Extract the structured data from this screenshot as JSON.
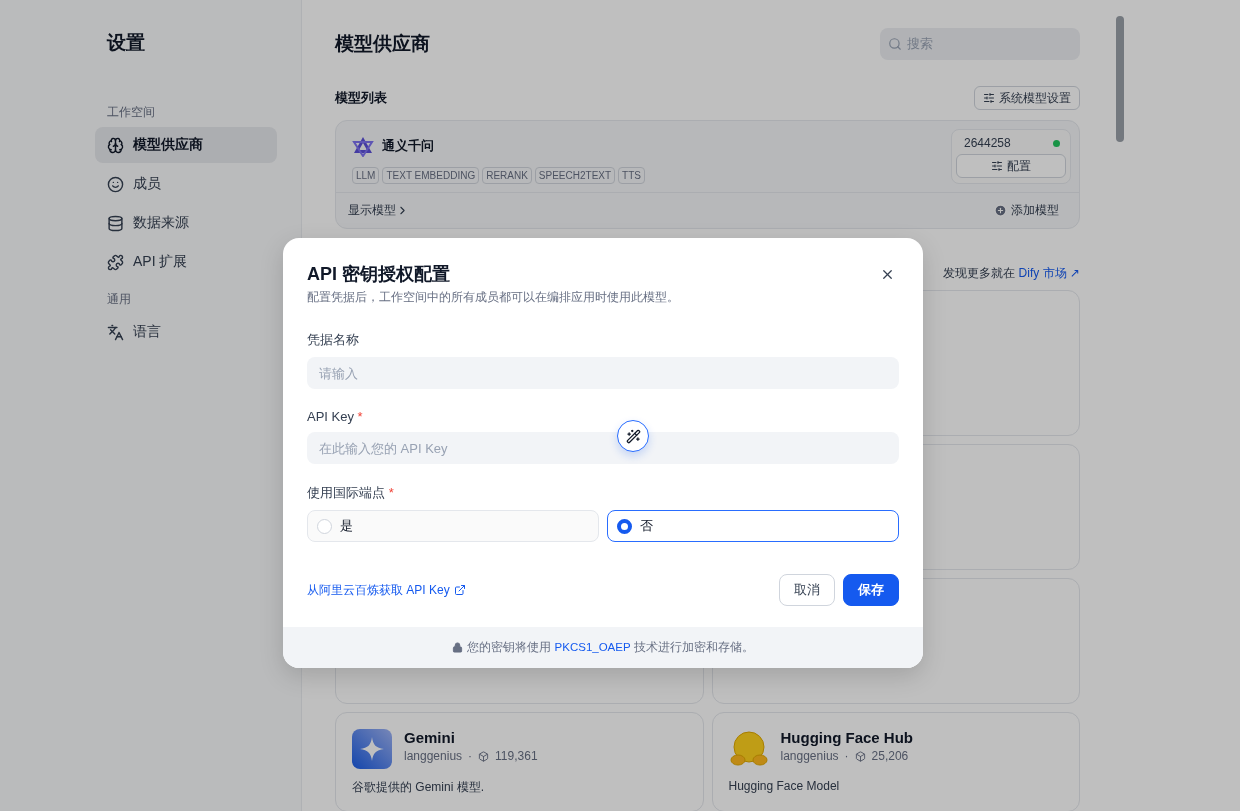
{
  "sidebar": {
    "title": "设置",
    "groups": [
      {
        "label": "工作空间",
        "items": [
          {
            "label": "模型供应商",
            "selected": true
          },
          {
            "label": "成员",
            "selected": false
          },
          {
            "label": "数据来源",
            "selected": false
          },
          {
            "label": "API 扩展",
            "selected": false
          }
        ]
      },
      {
        "label": "通用",
        "items": [
          {
            "label": "语言",
            "selected": false
          }
        ]
      }
    ]
  },
  "main": {
    "title": "模型供应商",
    "search": {
      "placeholder": "搜索"
    },
    "model_list": {
      "title": "模型列表",
      "settings_button": "系统模型设置",
      "provider": {
        "name": "通义千问",
        "tags": [
          "LLM",
          "TEXT EMBEDDING",
          "RERANK",
          "SPEECH2TEXT",
          "TTS"
        ],
        "quota": "2644258",
        "config_button": "配置",
        "show_models": "显示模型",
        "add_model": "添加模型"
      }
    },
    "marketplace": {
      "text": "发现更多就在",
      "link": "Dify 市场 ↗",
      "plugins": [
        {
          "kind": "covered"
        },
        {
          "kind": "covered"
        },
        {
          "kind": "covered"
        },
        {
          "kind": "covered"
        },
        {
          "kind": "plugin",
          "name": "Gemini",
          "author": "langgenius",
          "separator": "·",
          "installs": "119,361",
          "description": "谷歌提供的 Gemini 模型."
        },
        {
          "kind": "plugin",
          "name": "Hugging Face Hub",
          "author": "langgenius",
          "separator": "·",
          "installs": "25,206",
          "description": "Hugging Face Model"
        }
      ]
    }
  },
  "dialog": {
    "title": "API 密钥授权配置",
    "subtitle": "配置凭据后，工作空间中的所有成员都可以在编排应用时使用此模型。",
    "fields": [
      {
        "label": "凭据名称",
        "placeholder": "请输入"
      },
      {
        "label": "API Key",
        "required_mark": "*",
        "placeholder": "在此输入您的 API Key"
      }
    ],
    "radio": {
      "label": "使用国际端点",
      "required_mark": "*",
      "options": [
        {
          "label": "是",
          "selected": false
        },
        {
          "label": "否",
          "selected": true
        }
      ]
    },
    "link": "从阿里云百炼获取 API Key",
    "cancel": "取消",
    "save": "保存",
    "footer": {
      "before": "您的密钥将使用",
      "highlight": "PKCS1_OAEP",
      "after": "技术进行加密和存储。"
    }
  }
}
